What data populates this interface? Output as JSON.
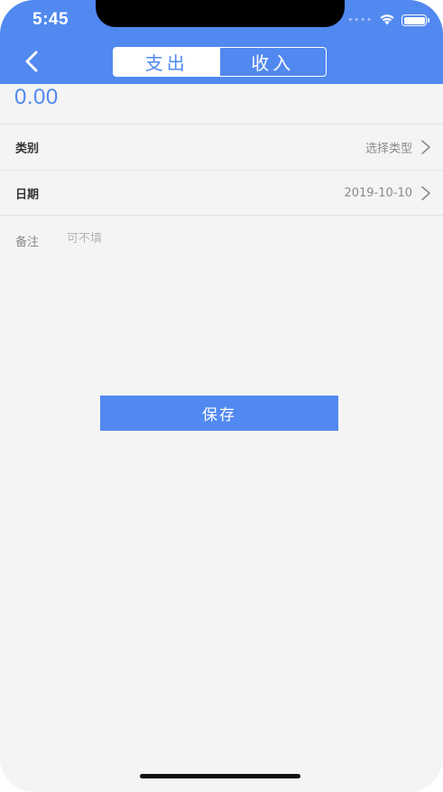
{
  "status_bar": {
    "time": "5:45",
    "signal_dots": "••••",
    "wifi_icon": "wifi-icon",
    "battery_icon": "battery-icon"
  },
  "nav": {
    "back_icon": "chevron-left-icon",
    "tabs": [
      {
        "label": "支出",
        "active": true
      },
      {
        "label": "收入",
        "active": false
      }
    ]
  },
  "form": {
    "amount": "0.00",
    "category": {
      "label": "类别",
      "value": "选择类型"
    },
    "date": {
      "label": "日期",
      "value": "2019-10-10"
    },
    "note": {
      "label": "备注",
      "placeholder": "可不填",
      "value": ""
    }
  },
  "actions": {
    "save_label": "保存"
  },
  "colors": {
    "accent": "#5189f0",
    "background": "#f4f4f4",
    "divider": "#e2e2e2",
    "muted_text": "#8a8a8a"
  }
}
